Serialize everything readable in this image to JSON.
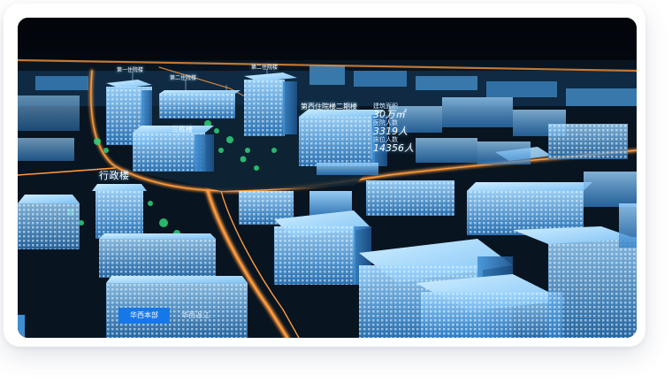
{
  "map": {
    "building_labels": {
      "inpatient_1": "第一住院楼",
      "inpatient_2": "第二住院楼",
      "inpatient_2b": "第二住院楼",
      "building_large": "三栋楼",
      "west_inpatient": "第西住院楼二期楼",
      "admin": "行政楼"
    },
    "stats": {
      "area_label": "建筑面积",
      "area_value": "30万㎡",
      "staff_label": "医院人数",
      "staff_value": "3319人",
      "beds_label": "床位人数",
      "beds_value": "14356人"
    }
  },
  "tabs": [
    {
      "label": "华西本部",
      "active": true
    },
    {
      "label": "华西温江",
      "active": false
    }
  ],
  "colors": {
    "accent": "#1677e8",
    "building": "#5fb6ff",
    "road": "#ff9a3c",
    "night": "#050a12"
  }
}
